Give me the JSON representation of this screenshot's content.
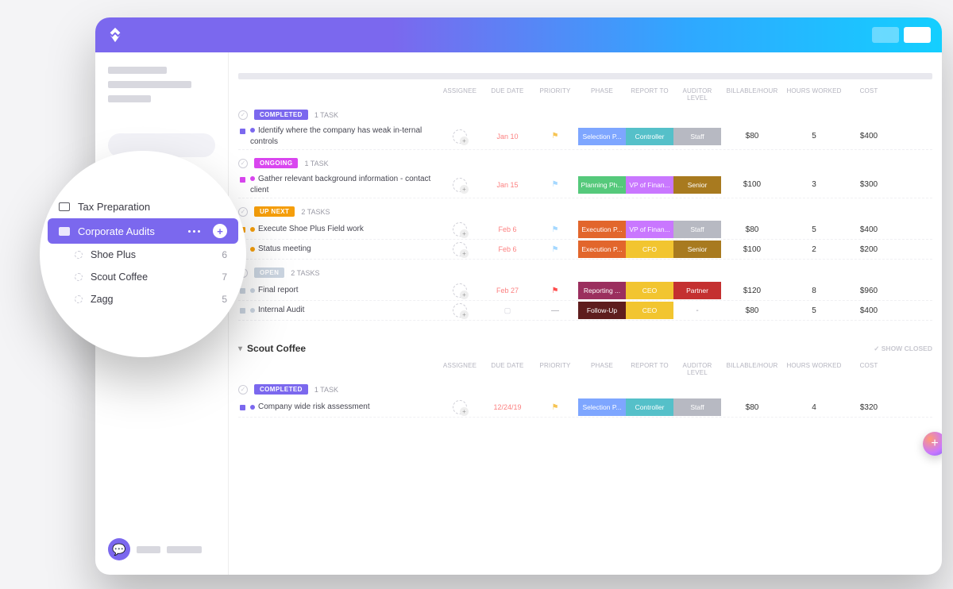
{
  "folders": {
    "tax": "Tax Preparation",
    "corp": "Corporate Audits",
    "lists": [
      {
        "name": "Shoe Plus",
        "count": "6"
      },
      {
        "name": "Scout Coffee",
        "count": "7"
      },
      {
        "name": "Zagg",
        "count": "5"
      }
    ]
  },
  "columns": {
    "assignee": "ASSIGNEE",
    "due": "DUE DATE",
    "priority": "PRIORITY",
    "phase": "PHASE",
    "report": "REPORT TO",
    "level": "AUDITOR LEVEL",
    "bill": "BILLABLE/HOUR",
    "hours": "HOURS WORKED",
    "cost": "COST"
  },
  "statuses": {
    "completed": {
      "label": "COMPLETED",
      "color": "#7b68ee"
    },
    "ongoing": {
      "label": "ONGOING",
      "color": "#d946ef"
    },
    "upnext": {
      "label": "UP NEXT",
      "color": "#f59e0b"
    },
    "open": {
      "label": "OPEN",
      "color": "#cbd5e1"
    }
  },
  "counts": {
    "one": "1 TASK",
    "two": "2 TASKS"
  },
  "pills": {
    "phase": {
      "selection": {
        "t": "Selection P...",
        "c": "#7ea6ff"
      },
      "planning": {
        "t": "Planning Ph...",
        "c": "#55c97b"
      },
      "execution": {
        "t": "Execution P...",
        "c": "#e2662c"
      },
      "reporting": {
        "t": "Reporting ...",
        "c": "#9b2f5e"
      },
      "followup": {
        "t": "Follow-Up",
        "c": "#5e1d1d"
      }
    },
    "report": {
      "controller": {
        "t": "Controller",
        "c": "#55c0c9"
      },
      "vpfin": {
        "t": "VP of Finan...",
        "c": "#c977ff"
      },
      "cfo": {
        "t": "CFO",
        "c": "#f2c530"
      },
      "ceo": {
        "t": "CEO",
        "c": "#f2c530"
      }
    },
    "level": {
      "staff": {
        "t": "Staff",
        "c": "#b7b9c2"
      },
      "senior": {
        "t": "Senior",
        "c": "#a87a1f"
      },
      "partner": {
        "t": "Partner",
        "c": "#c43030"
      }
    }
  },
  "groups": [
    {
      "status": "completed",
      "count": "one",
      "rows": [
        {
          "sq": "#7b68ee",
          "title": "Identify where the company has weak in-ternal controls",
          "dot": "⛔",
          "due": "Jan 10",
          "flag": "#f6c453",
          "phase": "selection",
          "report": "controller",
          "level": "staff",
          "bill": "$80",
          "hours": "5",
          "cost": "$400"
        }
      ]
    },
    {
      "status": "ongoing",
      "count": "one",
      "rows": [
        {
          "sq": "#d946ef",
          "title": "Gather relevant background information - contact client",
          "dot": "🟡",
          "due": "Jan 15",
          "flag": "#a5d8ff",
          "phase": "planning",
          "report": "vpfin",
          "level": "senior",
          "bill": "$100",
          "hours": "3",
          "cost": "$300"
        }
      ]
    },
    {
      "status": "upnext",
      "count": "two",
      "rows": [
        {
          "sq": "#f59e0b",
          "title": "Execute Shoe Plus Field work",
          "due": "Feb 6",
          "flag": "#a5d8ff",
          "phase": "execution",
          "report": "vpfin",
          "level": "staff",
          "bill": "$80",
          "hours": "5",
          "cost": "$400"
        },
        {
          "sq": "#f59e0b",
          "title": "Status meeting",
          "due": "Feb 6",
          "flag": "#a5d8ff",
          "phase": "execution",
          "report": "cfo",
          "level": "senior",
          "bill": "$100",
          "hours": "2",
          "cost": "$200"
        }
      ]
    },
    {
      "status": "open",
      "count": "two",
      "rows": [
        {
          "sq": "#cbd5e1",
          "title": "Final report",
          "due": "Feb 27",
          "flag": "#ff4d4d",
          "phase": "reporting",
          "report": "ceo",
          "level": "partner",
          "bill": "$120",
          "hours": "8",
          "cost": "$960"
        },
        {
          "sq": "#cbd5e1",
          "title": "Internal Audit",
          "due": "",
          "flag": "",
          "phase": "followup",
          "report": "ceo",
          "level": "-",
          "bill": "$80",
          "hours": "5",
          "cost": "$400"
        }
      ]
    }
  ],
  "section2": {
    "title": "Scout Coffee",
    "show_closed": "✓ SHOW CLOSED",
    "group": {
      "status": "completed",
      "count": "one",
      "rows": [
        {
          "sq": "#7b68ee",
          "title": "Company wide risk assessment",
          "due": "12/24/19",
          "flag": "#f6c453",
          "phase": "selection",
          "report": "controller",
          "level": "staff",
          "bill": "$80",
          "hours": "4",
          "cost": "$320"
        }
      ]
    }
  }
}
